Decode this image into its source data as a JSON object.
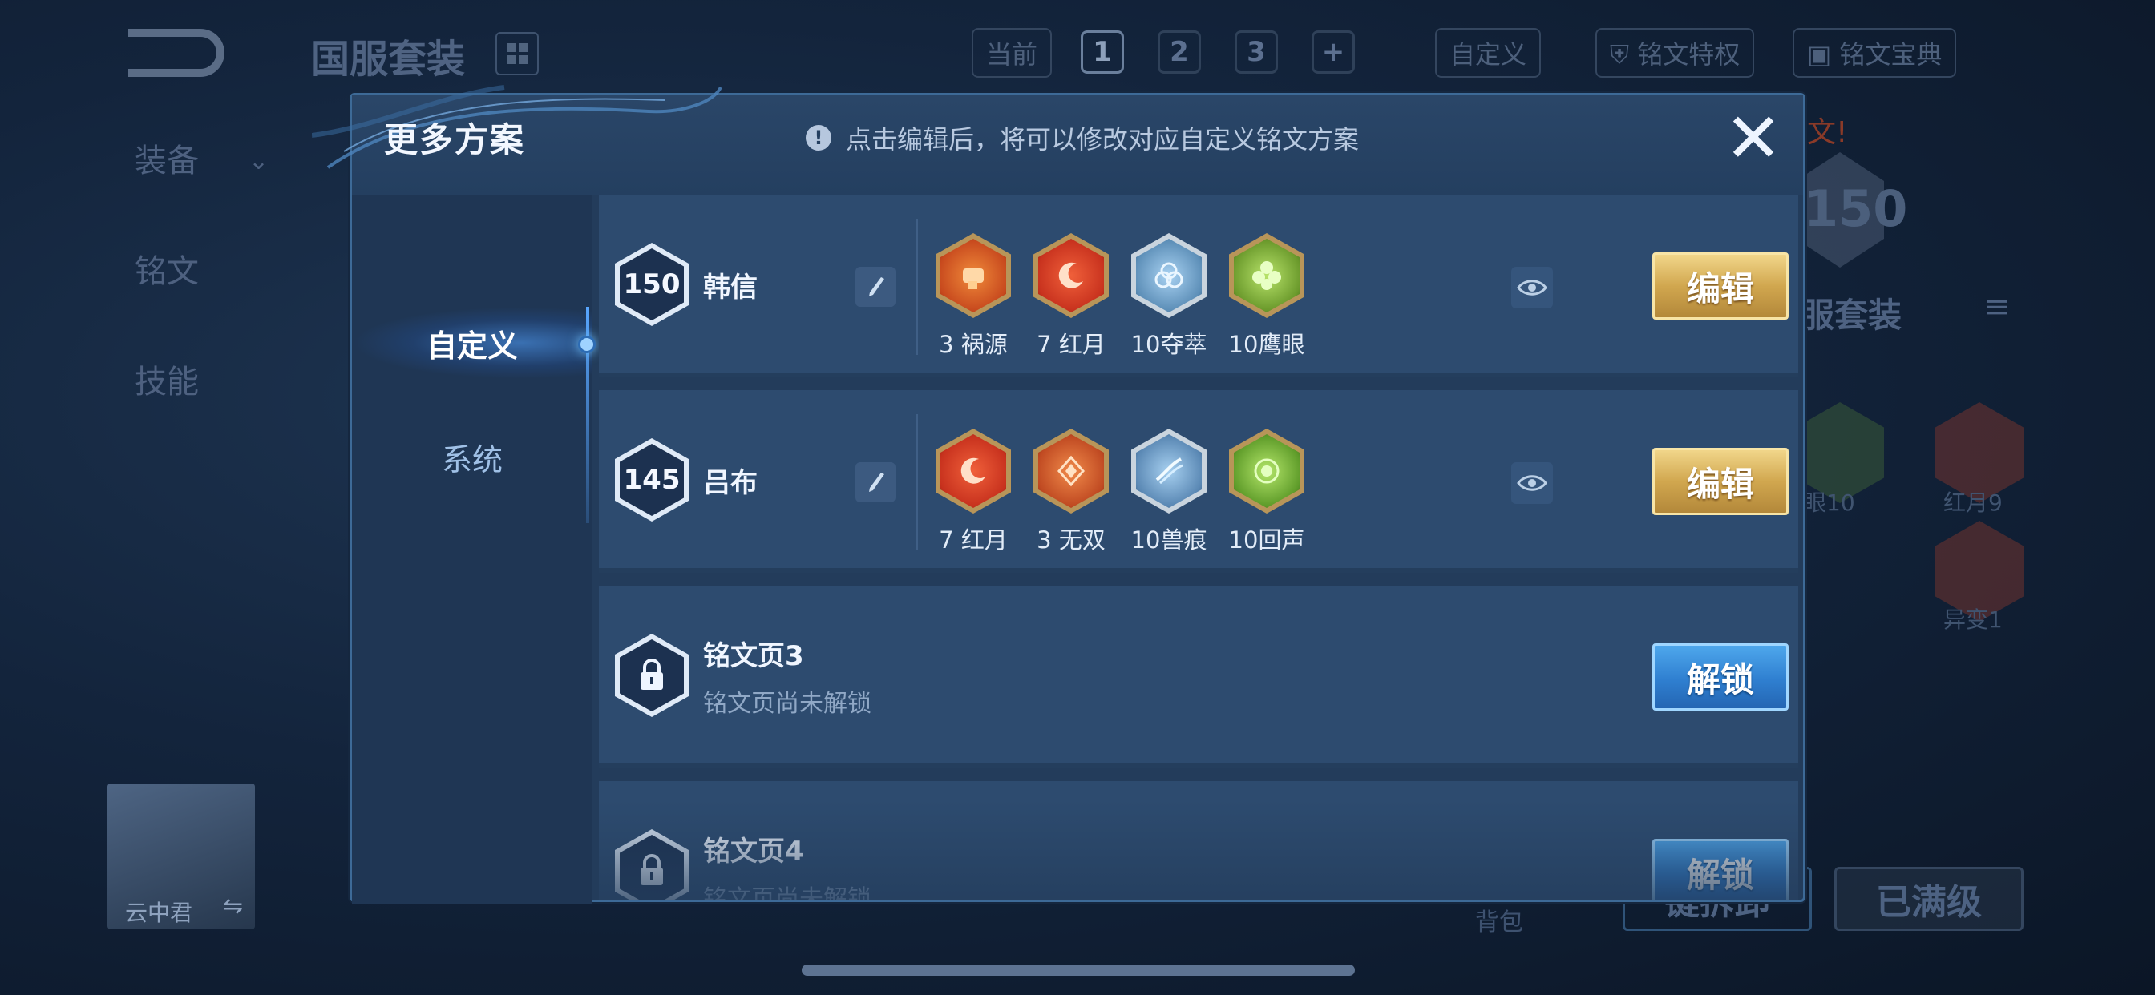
{
  "background": {
    "title": "国服套装",
    "side_menu": [
      "装备",
      "铭文",
      "技能"
    ],
    "topbar": {
      "current_label": "当前",
      "pages": [
        "1",
        "2",
        "3"
      ],
      "add_label": "+",
      "custom_label": "自定义",
      "privilege_label": "铭文特权",
      "codex_label": "铭文宝典"
    },
    "right_panel": {
      "level": "150",
      "set_name": "服套装",
      "runes": [
        {
          "label": "眼10"
        },
        {
          "label": "红月9"
        },
        {
          "label": "异变1"
        }
      ],
      "notice": "文!"
    },
    "hero_name": "云中君",
    "bag_label": "背包",
    "bottom_buttons": [
      "键拆卸",
      "已满级"
    ]
  },
  "modal": {
    "title": "更多方案",
    "tip": "点击编辑后，将可以修改对应自定义铭文方案",
    "tabs": [
      {
        "label": "自定义",
        "active": true
      },
      {
        "label": "系统",
        "active": false
      }
    ],
    "schemes": [
      {
        "level": "150",
        "hero": "韩信",
        "runes": [
          {
            "label": "3 祸源",
            "color": "#c84a1e",
            "icon": "fist-icon"
          },
          {
            "label": "7 红月",
            "color": "#c8321e",
            "icon": "crescent-moon-icon"
          },
          {
            "label": "10夺萃",
            "color": "#5d8fb8",
            "icon": "triquetra-icon"
          },
          {
            "label": "10鹰眼",
            "color": "#6b9a2c",
            "icon": "clover-icon"
          }
        ],
        "edit_label": "编辑"
      },
      {
        "level": "145",
        "hero": "吕布",
        "runes": [
          {
            "label": "7 红月",
            "color": "#c8321e",
            "icon": "crescent-moon-icon"
          },
          {
            "label": "3 无双",
            "color": "#c04a22",
            "icon": "diamond-swirl-icon"
          },
          {
            "label": "10兽痕",
            "color": "#5a88b4",
            "icon": "claw-icon"
          },
          {
            "label": "10回声",
            "color": "#5f9c2a",
            "icon": "orb-icon"
          }
        ],
        "edit_label": "编辑"
      }
    ],
    "locked_pages": [
      {
        "title": "铭文页3",
        "subtitle": "铭文页尚未解锁",
        "unlock_label": "解锁"
      },
      {
        "title": "铭文页4",
        "subtitle": "铭文页尚未解锁",
        "unlock_label": "解锁"
      }
    ]
  }
}
